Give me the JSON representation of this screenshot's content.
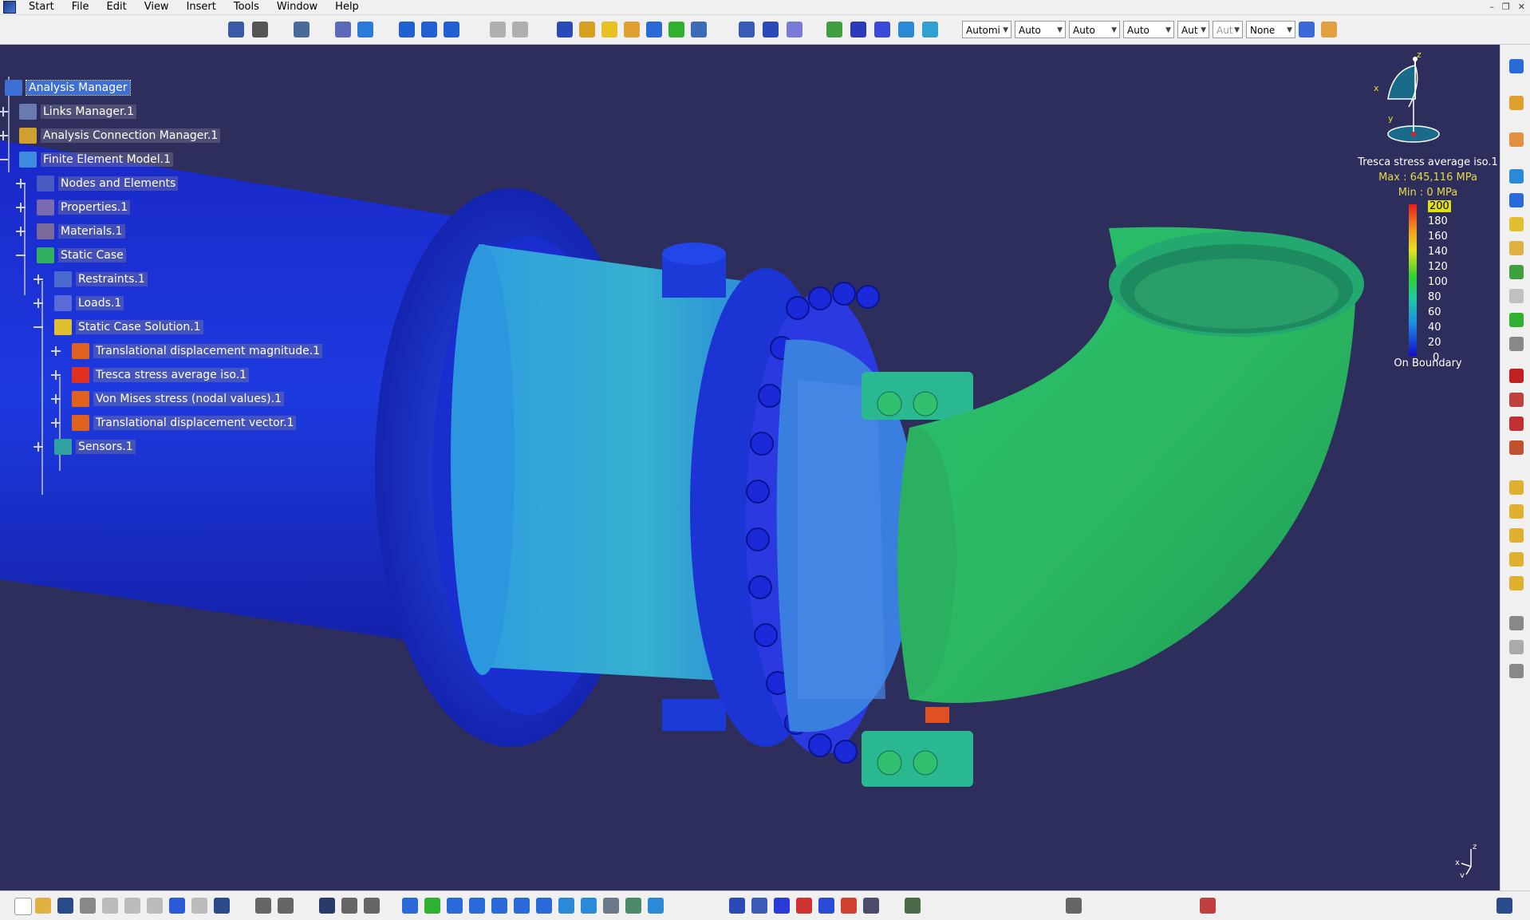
{
  "menu": [
    "Start",
    "File",
    "Edit",
    "View",
    "Insert",
    "Tools",
    "Window",
    "Help"
  ],
  "toolbar_combos": [
    "Automi",
    "Auto",
    "Auto",
    "Auto",
    "Aut",
    "Aut",
    "None"
  ],
  "tree": [
    {
      "label": "Analysis Manager",
      "depth": 0
    },
    {
      "label": "Links Manager.1",
      "depth": 0
    },
    {
      "label": "Analysis Connection Manager.1",
      "depth": 0
    },
    {
      "label": "Finite Element Model.1",
      "depth": 0
    },
    {
      "label": "Nodes and Elements",
      "depth": 1
    },
    {
      "label": "Properties.1",
      "depth": 1
    },
    {
      "label": "Materials.1",
      "depth": 1
    },
    {
      "label": "Static Case",
      "depth": 1
    },
    {
      "label": "Restraints.1",
      "depth": 2
    },
    {
      "label": "Loads.1",
      "depth": 2
    },
    {
      "label": "Static Case Solution.1",
      "depth": 2
    },
    {
      "label": "Translational displacement magnitude.1",
      "depth": 3
    },
    {
      "label": "Tresca stress average iso.1",
      "depth": 3
    },
    {
      "label": "Von Mises stress (nodal values).1",
      "depth": 3
    },
    {
      "label": "Translational displacement vector.1",
      "depth": 3
    },
    {
      "label": "Sensors.1",
      "depth": 2
    }
  ],
  "legend": {
    "title": "Tresca stress average iso.1",
    "max": "Max : 645,116 MPa",
    "min": "Min : 0 MPa",
    "ticks": [
      "200",
      "180",
      "160",
      "140",
      "120",
      "100",
      "80",
      "60",
      "40",
      "20",
      "0"
    ],
    "boundary": "On Boundary"
  },
  "compass": {
    "x": "x",
    "y": "y",
    "z": "z"
  },
  "axis": {
    "x": "x",
    "y": "y",
    "z": "z"
  },
  "colors": {
    "background": "#2e2e5c",
    "pipe_blue": "#1a2ad8",
    "highlight": "#3d6fd4"
  }
}
